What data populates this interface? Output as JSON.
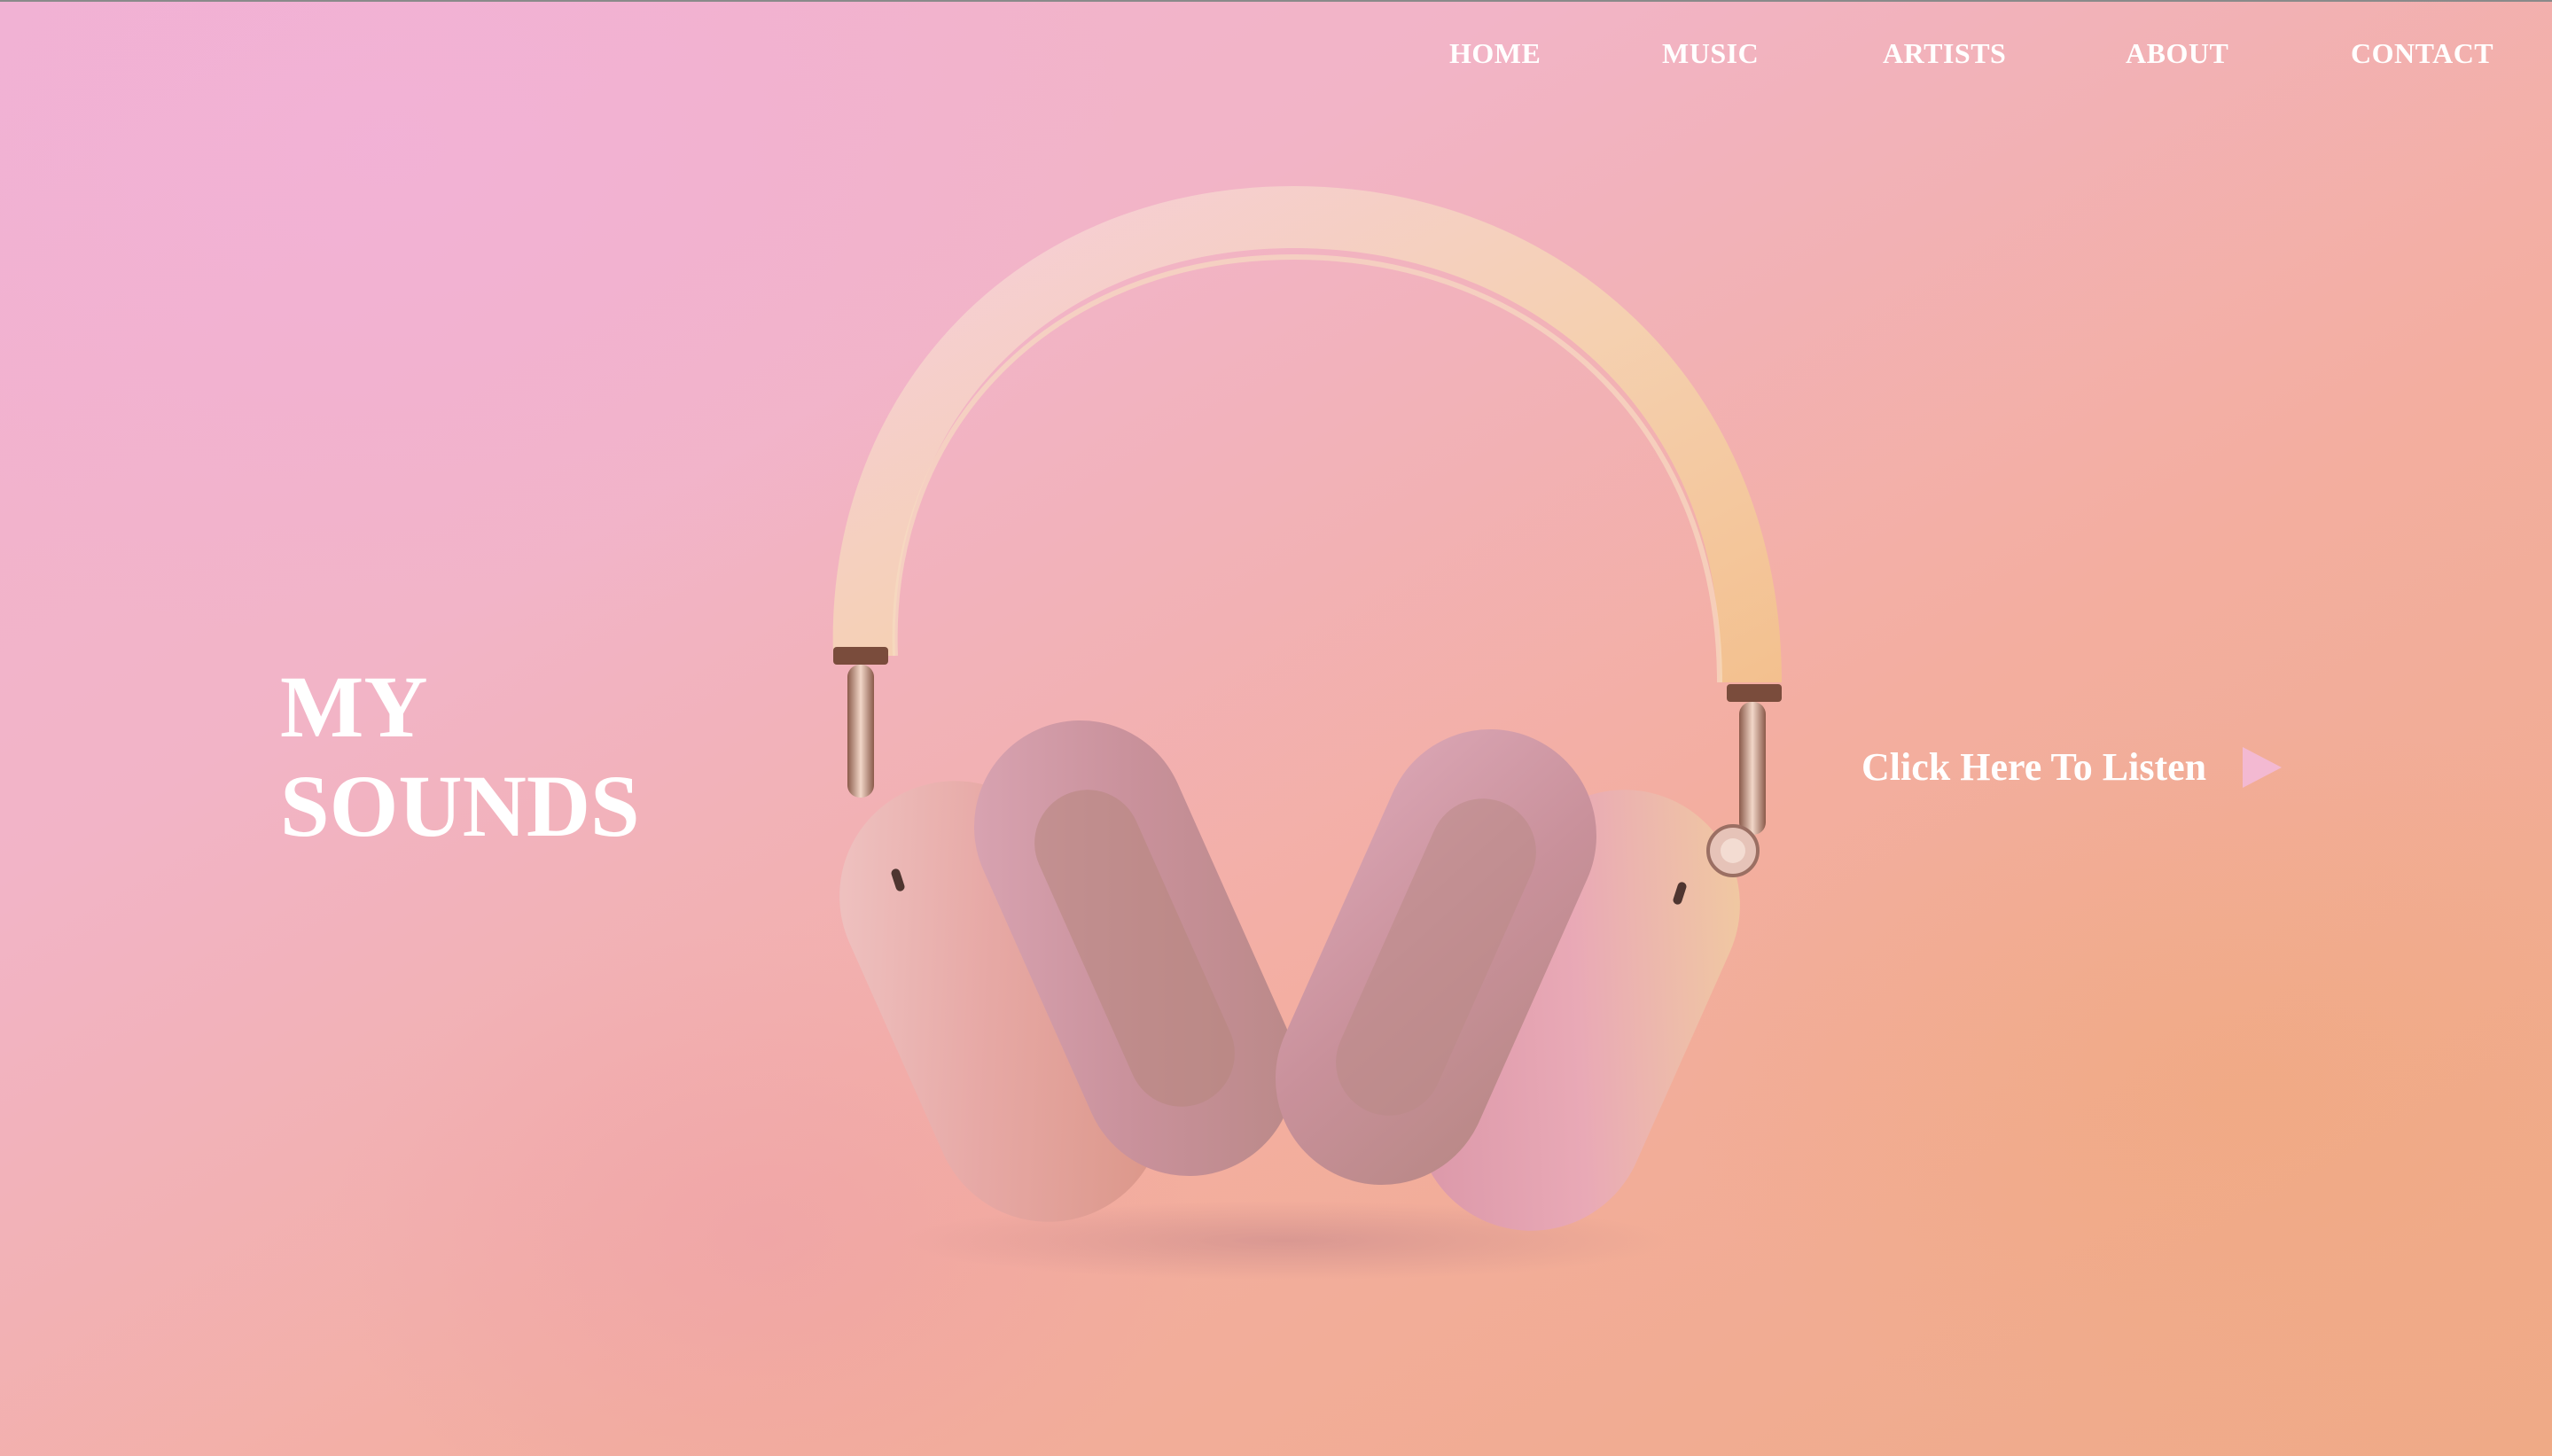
{
  "nav": {
    "items": [
      {
        "label": "HOME"
      },
      {
        "label": "MUSIC"
      },
      {
        "label": "ARTISTS"
      },
      {
        "label": "ABOUT"
      },
      {
        "label": "CONTACT"
      }
    ]
  },
  "hero": {
    "title_line1": "MY",
    "title_line2": "SOUNDS",
    "cta_label": "Click Here To Listen",
    "cta_icon": "play-icon"
  },
  "image": {
    "subject": "headphones-icon"
  },
  "colors": {
    "text": "#ffffff",
    "background_pink": "#f1b2d2",
    "background_peach": "#efaa86",
    "play_icon": "#f3b9d2"
  }
}
